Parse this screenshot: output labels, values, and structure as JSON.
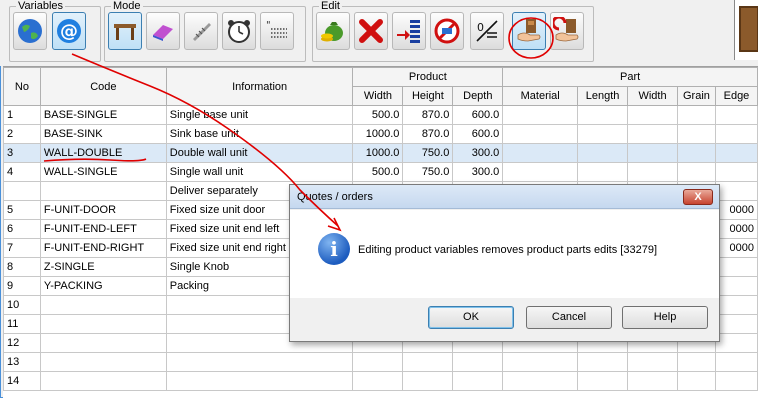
{
  "toolbar": {
    "groups": {
      "variables": "Variables",
      "mode": "Mode",
      "edit": "Edit"
    },
    "icons": [
      "globe-icon",
      "at-sign-icon",
      "table-icon",
      "eraser-icon",
      "screw-icon",
      "alarm-clock-icon",
      "dotted-text-icon",
      "money-bag-icon",
      "red-x-icon",
      "insert-arrow-icon",
      "prohibited-icon",
      "divide-zero-icon",
      "hand-product-icon",
      "undo-hand-icon"
    ]
  },
  "table": {
    "headers": {
      "no": "No",
      "code": "Code",
      "information": "Information",
      "product": "Product",
      "part": "Part",
      "width": "Width",
      "height": "Height",
      "depth": "Depth",
      "material": "Material",
      "length": "Length",
      "part_width": "Width",
      "grain": "Grain",
      "edge": "Edge"
    },
    "rows": [
      {
        "no": "1",
        "code": "BASE-SINGLE",
        "info": "Single base unit",
        "width": "500.0",
        "height": "870.0",
        "depth": "600.0",
        "edge": ""
      },
      {
        "no": "2",
        "code": "BASE-SINK",
        "info": "Sink base unit",
        "width": "1000.0",
        "height": "870.0",
        "depth": "600.0",
        "edge": ""
      },
      {
        "no": "3",
        "code": "WALL-DOUBLE",
        "info": "Double wall unit",
        "width": "1000.0",
        "height": "750.0",
        "depth": "300.0",
        "edge": ""
      },
      {
        "no": "4",
        "code": "WALL-SINGLE",
        "info": "Single wall unit",
        "width": "500.0",
        "height": "750.0",
        "depth": "300.0",
        "edge": ""
      },
      {
        "no": "",
        "code": "",
        "info": "Deliver separately",
        "width": "",
        "height": "",
        "depth": "",
        "edge": ""
      },
      {
        "no": "5",
        "code": "F-UNIT-DOOR",
        "info": "Fixed size unit door",
        "width": "",
        "height": "",
        "depth": "",
        "edge": "0000"
      },
      {
        "no": "6",
        "code": "F-UNIT-END-LEFT",
        "info": "Fixed size unit end left",
        "width": "",
        "height": "",
        "depth": "",
        "edge": "0000"
      },
      {
        "no": "7",
        "code": "F-UNIT-END-RIGHT",
        "info": "Fixed size unit end right",
        "width": "",
        "height": "",
        "depth": "",
        "edge": "0000"
      },
      {
        "no": "8",
        "code": "Z-SINGLE",
        "info": "Single Knob",
        "width": "",
        "height": "",
        "depth": "",
        "edge": ""
      },
      {
        "no": "9",
        "code": "Y-PACKING",
        "info": "Packing",
        "width": "",
        "height": "",
        "depth": "",
        "edge": ""
      },
      {
        "no": "10",
        "code": "",
        "info": "",
        "width": "",
        "height": "",
        "depth": "",
        "edge": ""
      },
      {
        "no": "11",
        "code": "",
        "info": "",
        "width": "",
        "height": "",
        "depth": "",
        "edge": ""
      },
      {
        "no": "12",
        "code": "",
        "info": "",
        "width": "",
        "height": "",
        "depth": "",
        "edge": ""
      },
      {
        "no": "13",
        "code": "",
        "info": "",
        "width": "",
        "height": "",
        "depth": "",
        "edge": ""
      },
      {
        "no": "14",
        "code": "",
        "info": "",
        "width": "",
        "height": "",
        "depth": "",
        "edge": ""
      }
    ]
  },
  "dialog": {
    "title": "Quotes / orders",
    "close_label": "X",
    "message": "Editing product variables removes product parts edits [33279]",
    "buttons": {
      "ok": "OK",
      "cancel": "Cancel",
      "help": "Help"
    }
  },
  "colors": {
    "selection_row": "#dbe9f7",
    "annotation_red": "#e00000",
    "title_bar": "#c5d8ef"
  }
}
